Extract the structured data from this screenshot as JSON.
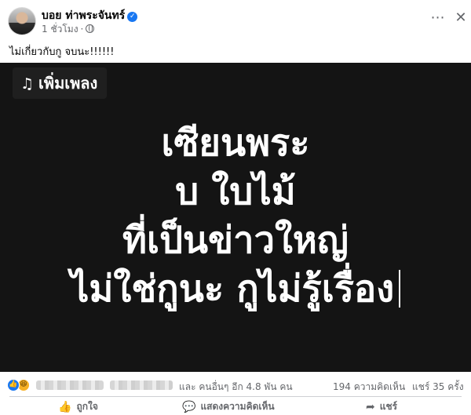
{
  "post": {
    "author": "บอย ท่าพระจันทร์",
    "time": "1 ชั่วโมง",
    "dot": "·",
    "caption": "ไม่เกี่ยวกับกู จบนะ!!!!!!",
    "icons": {
      "more": "more-icon",
      "close": "close-icon",
      "audience": "globe-icon",
      "verified": "verified-badge-icon"
    }
  },
  "media": {
    "music_label": "เพิ่มเพลง",
    "lines": [
      "เซียนพระ",
      "บ ใบไม้",
      "ที่เป็นข่าวใหญ่",
      "ไม่ใช่กูนะ กูไม่รู้เรื่อง"
    ],
    "background": "#141414"
  },
  "stats": {
    "reactions_text": "และ คนอื่นๆ อีก 4.8 พัน คน",
    "comments": "194 ความคิดเห็น",
    "shares": "แชร์ 35 ครั้ง"
  },
  "actions": {
    "like": "ถูกใจ",
    "comment": "แสดงความคิดเห็น",
    "share": "แชร์"
  },
  "colors": {
    "accent": "#1877f2",
    "secondary_text": "#65676b",
    "haha": "#f7b125"
  }
}
